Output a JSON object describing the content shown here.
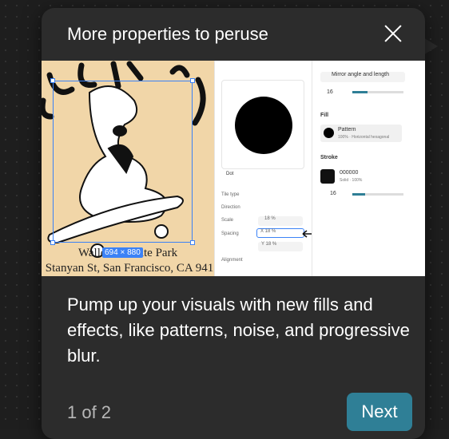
{
  "dialog": {
    "title": "More properties to peruse",
    "body": "Pump up your visuals with new fills and effects, like patterns, noise, and progressive blur.",
    "pager": "1 of 2",
    "next_label": "Next",
    "accent": "#2f7f96"
  },
  "media": {
    "art_caption_1": "Waller St Skate Park",
    "art_caption_2": "Stanyan St, San Francisco, CA 941",
    "dimension_badge": "694 × 880",
    "pattern_panel": {
      "label": "Dot",
      "tile_type": "Tile type",
      "direction": "Direction",
      "scale": "Scale",
      "scale_value": "18 %",
      "spacing": "Spacing",
      "spacing_x": "X  18 %",
      "spacing_y": "Y  18 %",
      "alignment": "Alignment"
    },
    "props_panel": {
      "mirror": "Mirror angle and length",
      "corner_value": "16",
      "fill_title": "Fill",
      "fill_name": "Pattern",
      "fill_sub": "100% · Horizontal hexagonal",
      "stroke_title": "Stroke",
      "stroke_hex": "000000",
      "stroke_sub": "Solid · 100%",
      "stroke_weight": "16"
    }
  }
}
